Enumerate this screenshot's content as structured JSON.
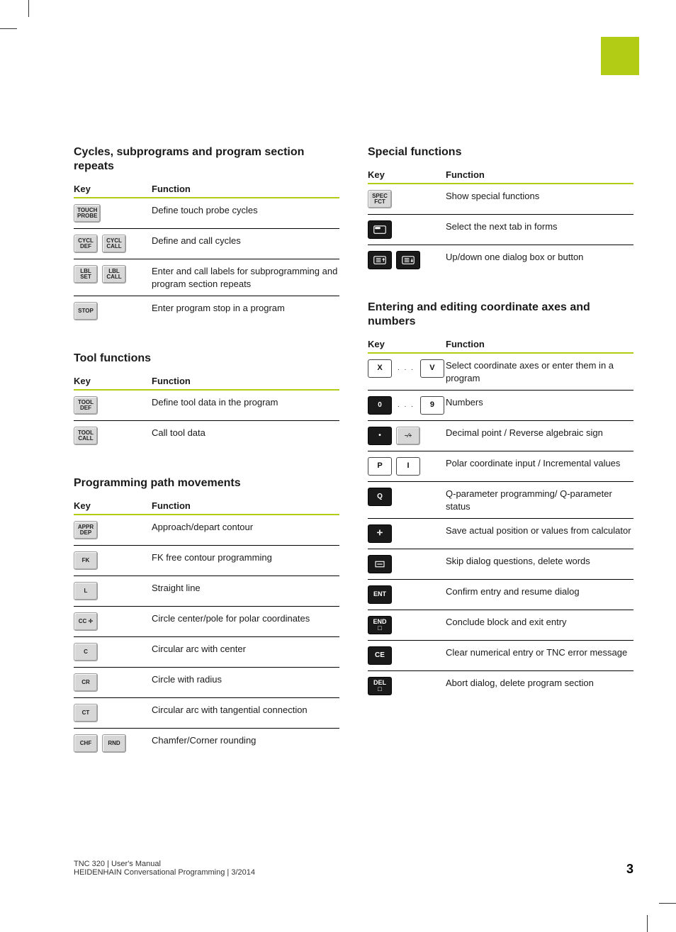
{
  "headers": {
    "key": "Key",
    "func": "Function"
  },
  "sections": {
    "cycles": {
      "title": "Cycles, subprograms and program section repeats",
      "rows": [
        {
          "keys": [
            {
              "t": "TOUCH\nPROBE",
              "s": "grey"
            }
          ],
          "func": "Define touch probe cycles"
        },
        {
          "keys": [
            {
              "t": "CYCL\nDEF",
              "s": "grey"
            },
            {
              "t": "CYCL\nCALL",
              "s": "grey"
            }
          ],
          "func": "Define and call cycles"
        },
        {
          "keys": [
            {
              "t": "LBL\nSET",
              "s": "grey"
            },
            {
              "t": "LBL\nCALL",
              "s": "grey"
            }
          ],
          "func": "Enter and call labels for subprogramming and program section repeats"
        },
        {
          "keys": [
            {
              "t": "STOP",
              "s": "grey"
            }
          ],
          "func": "Enter program stop in a program"
        }
      ]
    },
    "tool": {
      "title": "Tool functions",
      "rows": [
        {
          "keys": [
            {
              "t": "TOOL\nDEF",
              "s": "grey"
            }
          ],
          "func": "Define tool data in the program"
        },
        {
          "keys": [
            {
              "t": "TOOL\nCALL",
              "s": "grey"
            }
          ],
          "func": "Call tool data"
        }
      ]
    },
    "path": {
      "title": "Programming path movements",
      "rows": [
        {
          "keys": [
            {
              "t": "APPR\nDEP",
              "s": "grey"
            }
          ],
          "func": "Approach/depart contour"
        },
        {
          "keys": [
            {
              "t": "FK",
              "s": "grey"
            }
          ],
          "func": "FK free contour programming"
        },
        {
          "keys": [
            {
              "t": "L",
              "s": "grey"
            }
          ],
          "func": "Straight line"
        },
        {
          "keys": [
            {
              "t": "CC ✛",
              "s": "grey"
            }
          ],
          "func": "Circle center/pole for polar coordinates"
        },
        {
          "keys": [
            {
              "t": "C",
              "s": "grey"
            }
          ],
          "func": "Circular arc with center"
        },
        {
          "keys": [
            {
              "t": "CR",
              "s": "grey"
            }
          ],
          "func": "Circle with radius"
        },
        {
          "keys": [
            {
              "t": "CT",
              "s": "grey"
            }
          ],
          "func": "Circular arc with tangential connection"
        },
        {
          "keys": [
            {
              "t": "CHF",
              "s": "grey"
            },
            {
              "t": "RND",
              "s": "grey"
            }
          ],
          "func": "Chamfer/Corner rounding"
        }
      ]
    },
    "special": {
      "title": "Special functions",
      "rows": [
        {
          "keys": [
            {
              "t": "SPEC\nFCT",
              "s": "grey"
            }
          ],
          "func": "Show special functions"
        },
        {
          "keys": [
            {
              "svg": "tab",
              "s": "black"
            }
          ],
          "func": "Select the next tab in forms"
        },
        {
          "keys": [
            {
              "svg": "up",
              "s": "black"
            },
            {
              "svg": "down",
              "s": "black"
            }
          ],
          "func": "Up/down one dialog box or button"
        }
      ]
    },
    "entering": {
      "title": "Entering and editing coordinate axes and numbers",
      "rows": [
        {
          "keys": [
            {
              "t": "X",
              "s": "white"
            },
            {
              "dots": true
            },
            {
              "t": "V",
              "s": "white"
            }
          ],
          "func": "Select coordinate axes or enter them in a program"
        },
        {
          "keys": [
            {
              "t": "0",
              "s": "black bigtxt"
            },
            {
              "dots": true
            },
            {
              "t": "9",
              "s": "white"
            }
          ],
          "func": "Numbers"
        },
        {
          "keys": [
            {
              "t": "•",
              "s": "black bigtxt"
            },
            {
              "t": "−⁄+",
              "s": "grey"
            }
          ],
          "func": "Decimal point / Reverse algebraic sign"
        },
        {
          "keys": [
            {
              "t": "P",
              "s": "white"
            },
            {
              "t": "I",
              "s": "white"
            }
          ],
          "func": "Polar coordinate input / Incremental values"
        },
        {
          "keys": [
            {
              "t": "Q",
              "s": "black bigtxt"
            }
          ],
          "func": "Q-parameter programming/ Q-parameter status"
        },
        {
          "keys": [
            {
              "t": "✛",
              "s": "black bigtxt"
            }
          ],
          "func": "Save actual position or values from calculator"
        },
        {
          "keys": [
            {
              "svg": "noent",
              "s": "black"
            }
          ],
          "func": "Skip dialog questions, delete words"
        },
        {
          "keys": [
            {
              "t": "ENT",
              "s": "black"
            }
          ],
          "func": "Confirm entry and resume dialog"
        },
        {
          "keys": [
            {
              "t": "END\n□",
              "s": "black"
            }
          ],
          "func": "Conclude block and exit entry"
        },
        {
          "keys": [
            {
              "t": "CE",
              "s": "black bigtxt"
            }
          ],
          "func": "Clear numerical entry or TNC error message"
        },
        {
          "keys": [
            {
              "t": "DEL\n□",
              "s": "black"
            }
          ],
          "func": "Abort dialog, delete program section"
        }
      ]
    }
  },
  "footer": {
    "line1": "TNC 320 | User's Manual",
    "line2": "HEIDENHAIN Conversational Programming | 3/2014",
    "page": "3"
  }
}
